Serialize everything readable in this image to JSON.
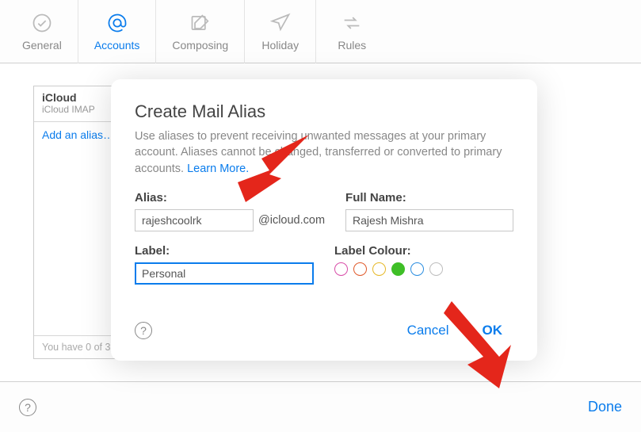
{
  "tabs": {
    "general": "General",
    "accounts": "Accounts",
    "composing": "Composing",
    "holiday": "Holiday",
    "rules": "Rules"
  },
  "sidebar": {
    "title": "iCloud",
    "subtitle": "iCloud IMAP",
    "add_link": "Add an alias…",
    "footer": "You have 0 of 3 aliases"
  },
  "modal": {
    "title": "Create Mail Alias",
    "desc": "Use aliases to prevent receiving unwanted messages at your primary account. Aliases cannot be changed, transferred or converted to primary accounts. ",
    "learn_more": "Learn More.",
    "alias_label": "Alias:",
    "alias_value": "rajeshcoolrk",
    "alias_suffix": "@icloud.com",
    "fullname_label": "Full Name:",
    "fullname_value": "Rajesh Mishra",
    "label_label": "Label:",
    "label_value": "Personal",
    "colour_label": "Label Colour:",
    "colours": [
      {
        "hex": "#d84ca8",
        "selected": false
      },
      {
        "hex": "#e0592a",
        "selected": false
      },
      {
        "hex": "#e6b827",
        "selected": false
      },
      {
        "hex": "#3fbf27",
        "selected": true
      },
      {
        "hex": "#2a8de0",
        "selected": false
      },
      {
        "hex": "#bdbdbd",
        "selected": false
      }
    ],
    "cancel": "Cancel",
    "ok": "OK"
  },
  "footer": {
    "done": "Done"
  }
}
